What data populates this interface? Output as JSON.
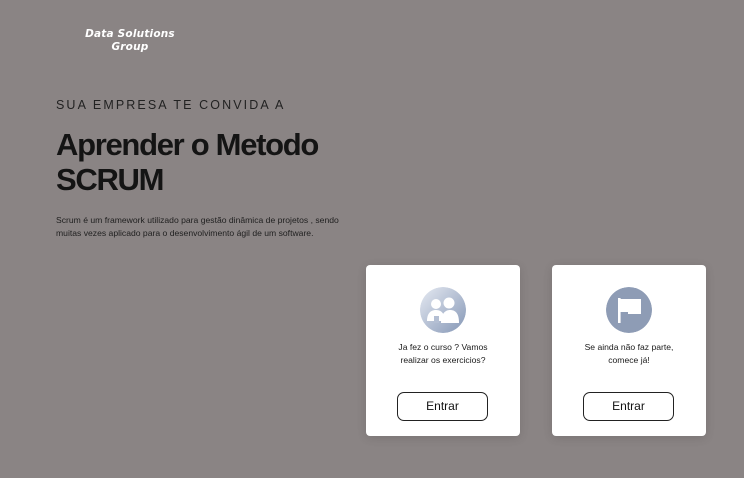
{
  "logo": {
    "line1": "Data Solutions",
    "line2": "Group"
  },
  "hero": {
    "invite": "SUA EMPRESA TE CONVIDA A",
    "title_line1": "Aprender o Metodo",
    "title_line2": "SCRUM",
    "description_line1": "Scrum é um framework utilizado para gestão dinâmica de projetos , sendo",
    "description_line2": "muitas vezes aplicado para o desenvolvimento ágil de um software."
  },
  "cards": [
    {
      "icon": "group-users-icon",
      "text_line1": "Ja fez o curso ? Vamos",
      "text_line2": "realizar os exercicios?",
      "button_label": "Entrar"
    },
    {
      "icon": "flag-icon",
      "text_line1": "Se ainda não faz parte,",
      "text_line2": "comece já!",
      "button_label": "Entrar"
    }
  ],
  "colors": {
    "background": "#8a8484",
    "card": "#ffffff",
    "icon_gradient_start": "#dfe4ee",
    "icon_gradient_end": "#8b9bb8",
    "flag_icon_fill": "#8e9cb5",
    "heading_text": "#141414"
  }
}
